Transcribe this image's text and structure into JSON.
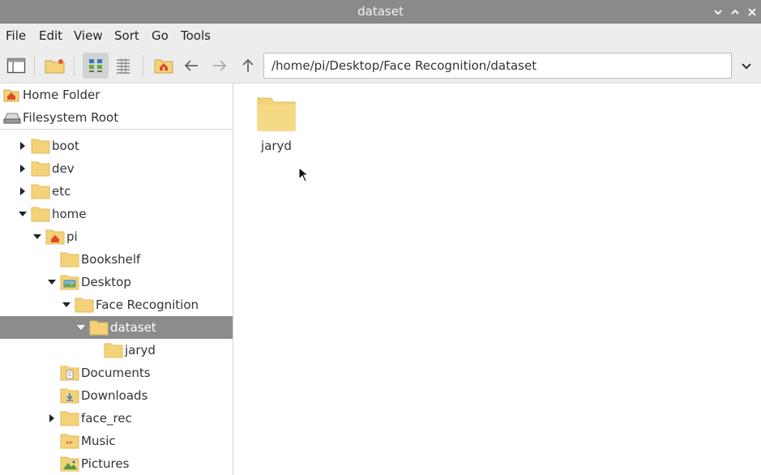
{
  "window": {
    "title": "dataset"
  },
  "menu": [
    "File",
    "Edit",
    "View",
    "Sort",
    "Go",
    "Tools"
  ],
  "toolbar": {
    "path": "/home/pi/Desktop/Face Recognition/dataset"
  },
  "places": {
    "home": "Home Folder",
    "root": "Filesystem Root"
  },
  "tree": [
    {
      "label": "boot"
    },
    {
      "label": "dev"
    },
    {
      "label": "etc"
    },
    {
      "label": "home"
    },
    {
      "label": "pi"
    },
    {
      "label": "Bookshelf"
    },
    {
      "label": "Desktop"
    },
    {
      "label": "Face Recognition"
    },
    {
      "label": "dataset"
    },
    {
      "label": "jaryd"
    },
    {
      "label": "Documents"
    },
    {
      "label": "Downloads"
    },
    {
      "label": "face_rec"
    },
    {
      "label": "Music"
    },
    {
      "label": "Pictures"
    }
  ],
  "files": [
    {
      "name": "jaryd"
    }
  ],
  "colors": {
    "folder": "#f4d27a",
    "folder_dark": "#e8bd55",
    "selection": "#8c8c8c",
    "titlebar": "#8a8a8a"
  }
}
